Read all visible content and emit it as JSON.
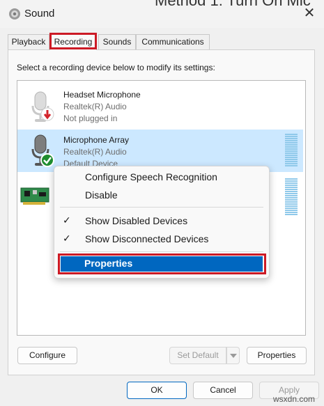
{
  "window": {
    "title": "Sound",
    "background_heading": "Method 1: Turn On Mic",
    "close_icon": "close-icon",
    "app_icon": "speaker-icon"
  },
  "tabs": [
    {
      "label": "Playback",
      "selected": false
    },
    {
      "label": "Recording",
      "selected": true
    },
    {
      "label": "Sounds",
      "selected": false
    },
    {
      "label": "Communications",
      "selected": false
    }
  ],
  "instruction": "Select a recording device below to modify its settings:",
  "devices": [
    {
      "name": "Headset Microphone",
      "driver": "Realtek(R) Audio",
      "status": "Not plugged in",
      "icon": "microphone-icon",
      "badge": "down-arrow-red-icon"
    },
    {
      "name": "Microphone Array",
      "driver": "Realtek(R) Audio",
      "status": "Default Device",
      "icon": "microphone-icon",
      "badge": "check-green-icon",
      "selected": true
    },
    {
      "name": "",
      "driver": "",
      "status": "",
      "icon": "sound-card-icon"
    }
  ],
  "context_menu": {
    "items": [
      {
        "label": "Configure Speech Recognition",
        "checked": false
      },
      {
        "label": "Disable",
        "checked": false
      },
      {
        "label": "Show Disabled Devices",
        "checked": true
      },
      {
        "label": "Show Disconnected Devices",
        "checked": true
      },
      {
        "label": "Properties",
        "checked": false,
        "highlighted": true
      }
    ],
    "check_glyph": "✓"
  },
  "buttons": {
    "configure": "Configure",
    "set_default": "Set Default",
    "properties": "Properties",
    "ok": "OK",
    "cancel": "Cancel",
    "apply": "Apply"
  },
  "watermark": "wsxdn.com",
  "colors": {
    "highlight_red": "#cc1a25",
    "selection_blue": "#cce8ff",
    "menu_selection": "#0067c0",
    "check_green": "#1e8c2e",
    "badge_red": "#d3242b"
  }
}
